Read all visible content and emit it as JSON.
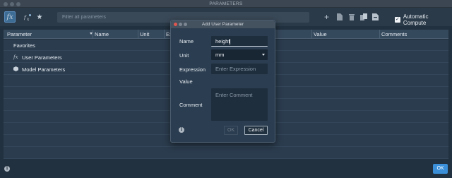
{
  "window": {
    "title": "PARAMETERS"
  },
  "toolbar": {
    "filter_placeholder": "Filter all parameters",
    "fx_glyph": "fx",
    "automatic_compute_label": "Automatic Compute",
    "automatic_compute_checked": true,
    "icons": [
      "fx-icon",
      "user-fx-icon",
      "star-icon",
      "add-icon",
      "doc-icon",
      "trash-icon",
      "export-icon",
      "import-icon"
    ]
  },
  "table": {
    "columns": [
      "Parameter",
      "Name",
      "Unit",
      "Ex",
      "Value",
      "Comments"
    ],
    "rows": [
      {
        "label": "Favorites",
        "icon": ""
      },
      {
        "label": "User Parameters",
        "icon": "fx"
      },
      {
        "label": "Model Parameters",
        "icon": "cube"
      }
    ]
  },
  "dialog": {
    "title": "Add User Parameter",
    "name_label": "Name",
    "name_value": "height",
    "unit_label": "Unit",
    "unit_value": "mm",
    "expression_label": "Expression",
    "expression_placeholder": "Enter Expression",
    "value_label": "Value",
    "comment_label": "Comment",
    "comment_placeholder": "Enter Comment",
    "ok_label": "OK",
    "cancel_label": "Cancel"
  },
  "footer": {
    "ok_label": "OK"
  },
  "colors": {
    "accent": "#3a8fd8",
    "background": "#22313f",
    "panel": "#2b3c4e"
  }
}
